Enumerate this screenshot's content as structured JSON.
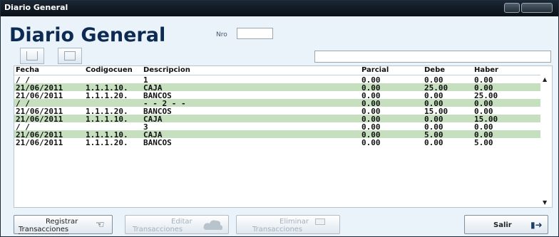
{
  "window": {
    "title": "Diario General"
  },
  "header": {
    "title": "Diario General",
    "nro_label": "Nro",
    "nro_value": ""
  },
  "search": {
    "value": ""
  },
  "table": {
    "columns": [
      "Fecha",
      "Codigocuen",
      "Descripcion",
      "Parcial",
      "Debe",
      "Haber"
    ],
    "rows": [
      [
        "/ /",
        "",
        "1",
        "0.00",
        "0.00",
        "0.00"
      ],
      [
        "21/06/2011",
        "1.1.1.10.",
        "CAJA",
        "0.00",
        "25.00",
        "0.00"
      ],
      [
        "21/06/2011",
        "1.1.1.20.",
        "BANCOS",
        "0.00",
        "0.00",
        "25.00"
      ],
      [
        "/ /",
        "",
        "- - 2 - -",
        "0.00",
        "0.00",
        "0.00"
      ],
      [
        "21/06/2011",
        "1.1.1.20.",
        "BANCOS",
        "0.00",
        "15.00",
        "0.00"
      ],
      [
        "21/06/2011",
        "1.1.1.10.",
        "CAJA",
        "0.00",
        "0.00",
        "15.00"
      ],
      [
        "/ /",
        "",
        "3",
        "0.00",
        "0.00",
        "0.00"
      ],
      [
        "21/06/2011",
        "1.1.1.10.",
        "CAJA",
        "0.00",
        "5.00",
        "0.00"
      ],
      [
        "21/06/2011",
        "1.1.1.20.",
        "BANCOS",
        "0.00",
        "0.00",
        "5.00"
      ]
    ]
  },
  "buttons": {
    "registrar": {
      "line1": "Registrar",
      "line2": "Transacciones"
    },
    "editar": {
      "line1": "Editar",
      "line2": "Transacciones"
    },
    "eliminar": {
      "line1": "Eliminar",
      "line2": "Transacciones"
    },
    "salir": {
      "label": "Salir"
    }
  },
  "colors": {
    "row_highlight": "#c5dfbf",
    "title_bar": "#0a1118",
    "heading": "#0d2a52"
  },
  "icons": [
    "new-document-icon",
    "copy-document-icon",
    "hand-cursor-icon",
    "cloud-icon",
    "eraser-icon",
    "exit-door-icon",
    "scroll-up-arrow-icon",
    "scroll-down-arrow-icon"
  ]
}
